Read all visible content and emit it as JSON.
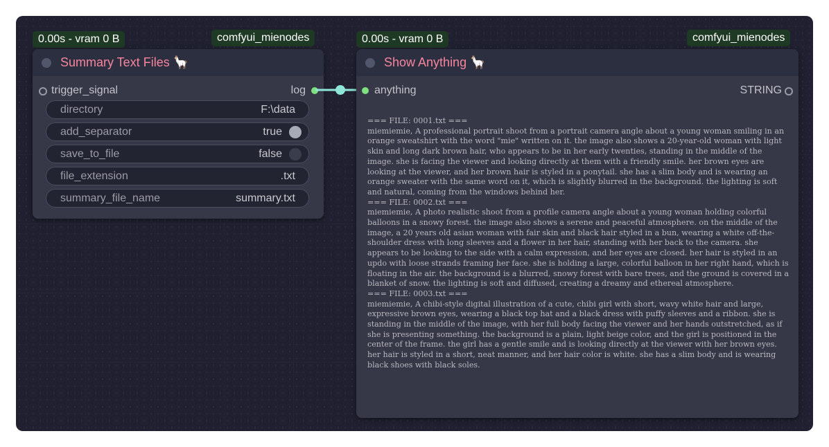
{
  "node_left": {
    "timing_badge": "0.00s - vram 0 B",
    "source_badge": "comfyui_mienodes",
    "title": "Summary Text Files",
    "title_emoji": "🦙",
    "input_slot": "trigger_signal",
    "output_slot": "log",
    "widgets": [
      {
        "label": "directory",
        "value": "F:\\data"
      },
      {
        "label": "add_separator",
        "value": "true"
      },
      {
        "label": "save_to_file",
        "value": "false"
      },
      {
        "label": "file_extension",
        "value": ".txt"
      },
      {
        "label": "summary_file_name",
        "value": "summary.txt"
      }
    ]
  },
  "node_right": {
    "timing_badge": "0.00s - vram 0 B",
    "source_badge": "comfyui_mienodes",
    "title": "Show Anything",
    "title_emoji": "🦙",
    "input_slot": "anything",
    "output_slot": "STRING",
    "output_text": "=== FILE: 0001.txt ===\nmiemiemie, A professional portrait shoot from a portrait camera angle about a young woman smiling in an orange sweatshirt with the word \"mie\" written on it. the image also shows a 20-year-old woman with light skin and long dark brown hair, who appears to be in her early twenties, standing in the middle of the image. she is facing the viewer and looking directly at them with a friendly smile. her brown eyes are looking at the viewer, and her brown hair is styled in a ponytail. she has a slim body and is wearing an orange sweater with the same word on it, which is slightly blurred in the background. the lighting is soft and natural, coming from the windows behind her.\n=== FILE: 0002.txt ===\nmiemiemie, A photo realistic shoot from a profile camera angle about a young woman holding colorful balloons in a snowy forest. the image also shows a serene and peaceful atmosphere. on the middle of the image, a 20 years old asian woman with fair skin and black hair styled in a bun, wearing a white off-the-shoulder dress with long sleeves and a flower in her hair, standing with her back to the camera. she appears to be looking to the side with a calm expression, and her eyes are closed. her hair is styled in an updo with loose strands framing her face. she is holding a large, colorful balloon in her right hand, which is floating in the air. the background is a blurred, snowy forest with bare trees, and the ground is covered in a blanket of snow. the lighting is soft and diffused, creating a dreamy and ethereal atmosphere.\n=== FILE: 0003.txt ===\nmiemiemie, A chibi-style digital illustration of a cute, chibi girl with short, wavy white hair and large, expressive brown eyes, wearing a black top hat and a black dress with puffy sleeves and a ribbon. she is standing in the middle of the image, with her full body facing the viewer and her hands outstretched, as if she is presenting something. the background is a plain, light beige color, and the girl is positioned in the center of the frame. the girl has a gentle smile and is looking directly at the viewer with her brown eyes. her hair is styled in a short, neat manner, and her hair color is white. she has a slim body and is wearing black shoes with black soles."
  },
  "colors": {
    "canvas_bg": "#202030",
    "node_bg": "#363848",
    "node_header": "#2b2f3f",
    "title": "#f7859e",
    "badge_bg": "#1f3a24",
    "link": "#8ee6d8",
    "slot_active": "#7ee07e"
  }
}
